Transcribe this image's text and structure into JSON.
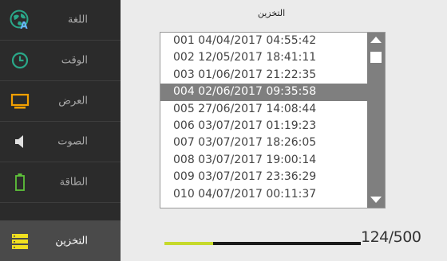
{
  "sidebar": {
    "items": [
      {
        "label": "اللغة",
        "icon": "globe-icon",
        "active": false
      },
      {
        "label": "الوقت",
        "icon": "clock-icon",
        "active": false
      },
      {
        "label": "العرض",
        "icon": "monitor-icon",
        "active": false
      },
      {
        "label": "الصوت",
        "icon": "speaker-icon",
        "active": false
      },
      {
        "label": "الطاقة",
        "icon": "battery-icon",
        "active": false
      },
      {
        "label": "التخزين",
        "icon": "storage-icon",
        "active": true
      }
    ]
  },
  "main": {
    "title": "التخزين",
    "records": [
      "001 04/04/2017 04:55:42",
      "002 12/05/2017 18:41:11",
      "003 01/06/2017 21:22:35",
      "004 02/06/2017 09:35:58",
      "005 27/06/2017 14:08:44",
      "006 03/07/2017 01:19:23",
      "007 03/07/2017 18:26:05",
      "008 03/07/2017 19:00:14",
      "009 03/07/2017 23:36:29",
      "010 04/07/2017 00:11:37"
    ],
    "selected_index": 3,
    "storage_count": "124/500",
    "storage_used_fraction": 0.248
  },
  "colors": {
    "sidebar_bg": "#2b2b2b",
    "sidebar_active_bg": "#4a4a4a",
    "icon_teal": "#2aa889",
    "icon_orange": "#f4a000",
    "icon_yellow": "#f0e020",
    "progress_fill": "#c6d92b",
    "selected_row": "#7f7f7f"
  }
}
